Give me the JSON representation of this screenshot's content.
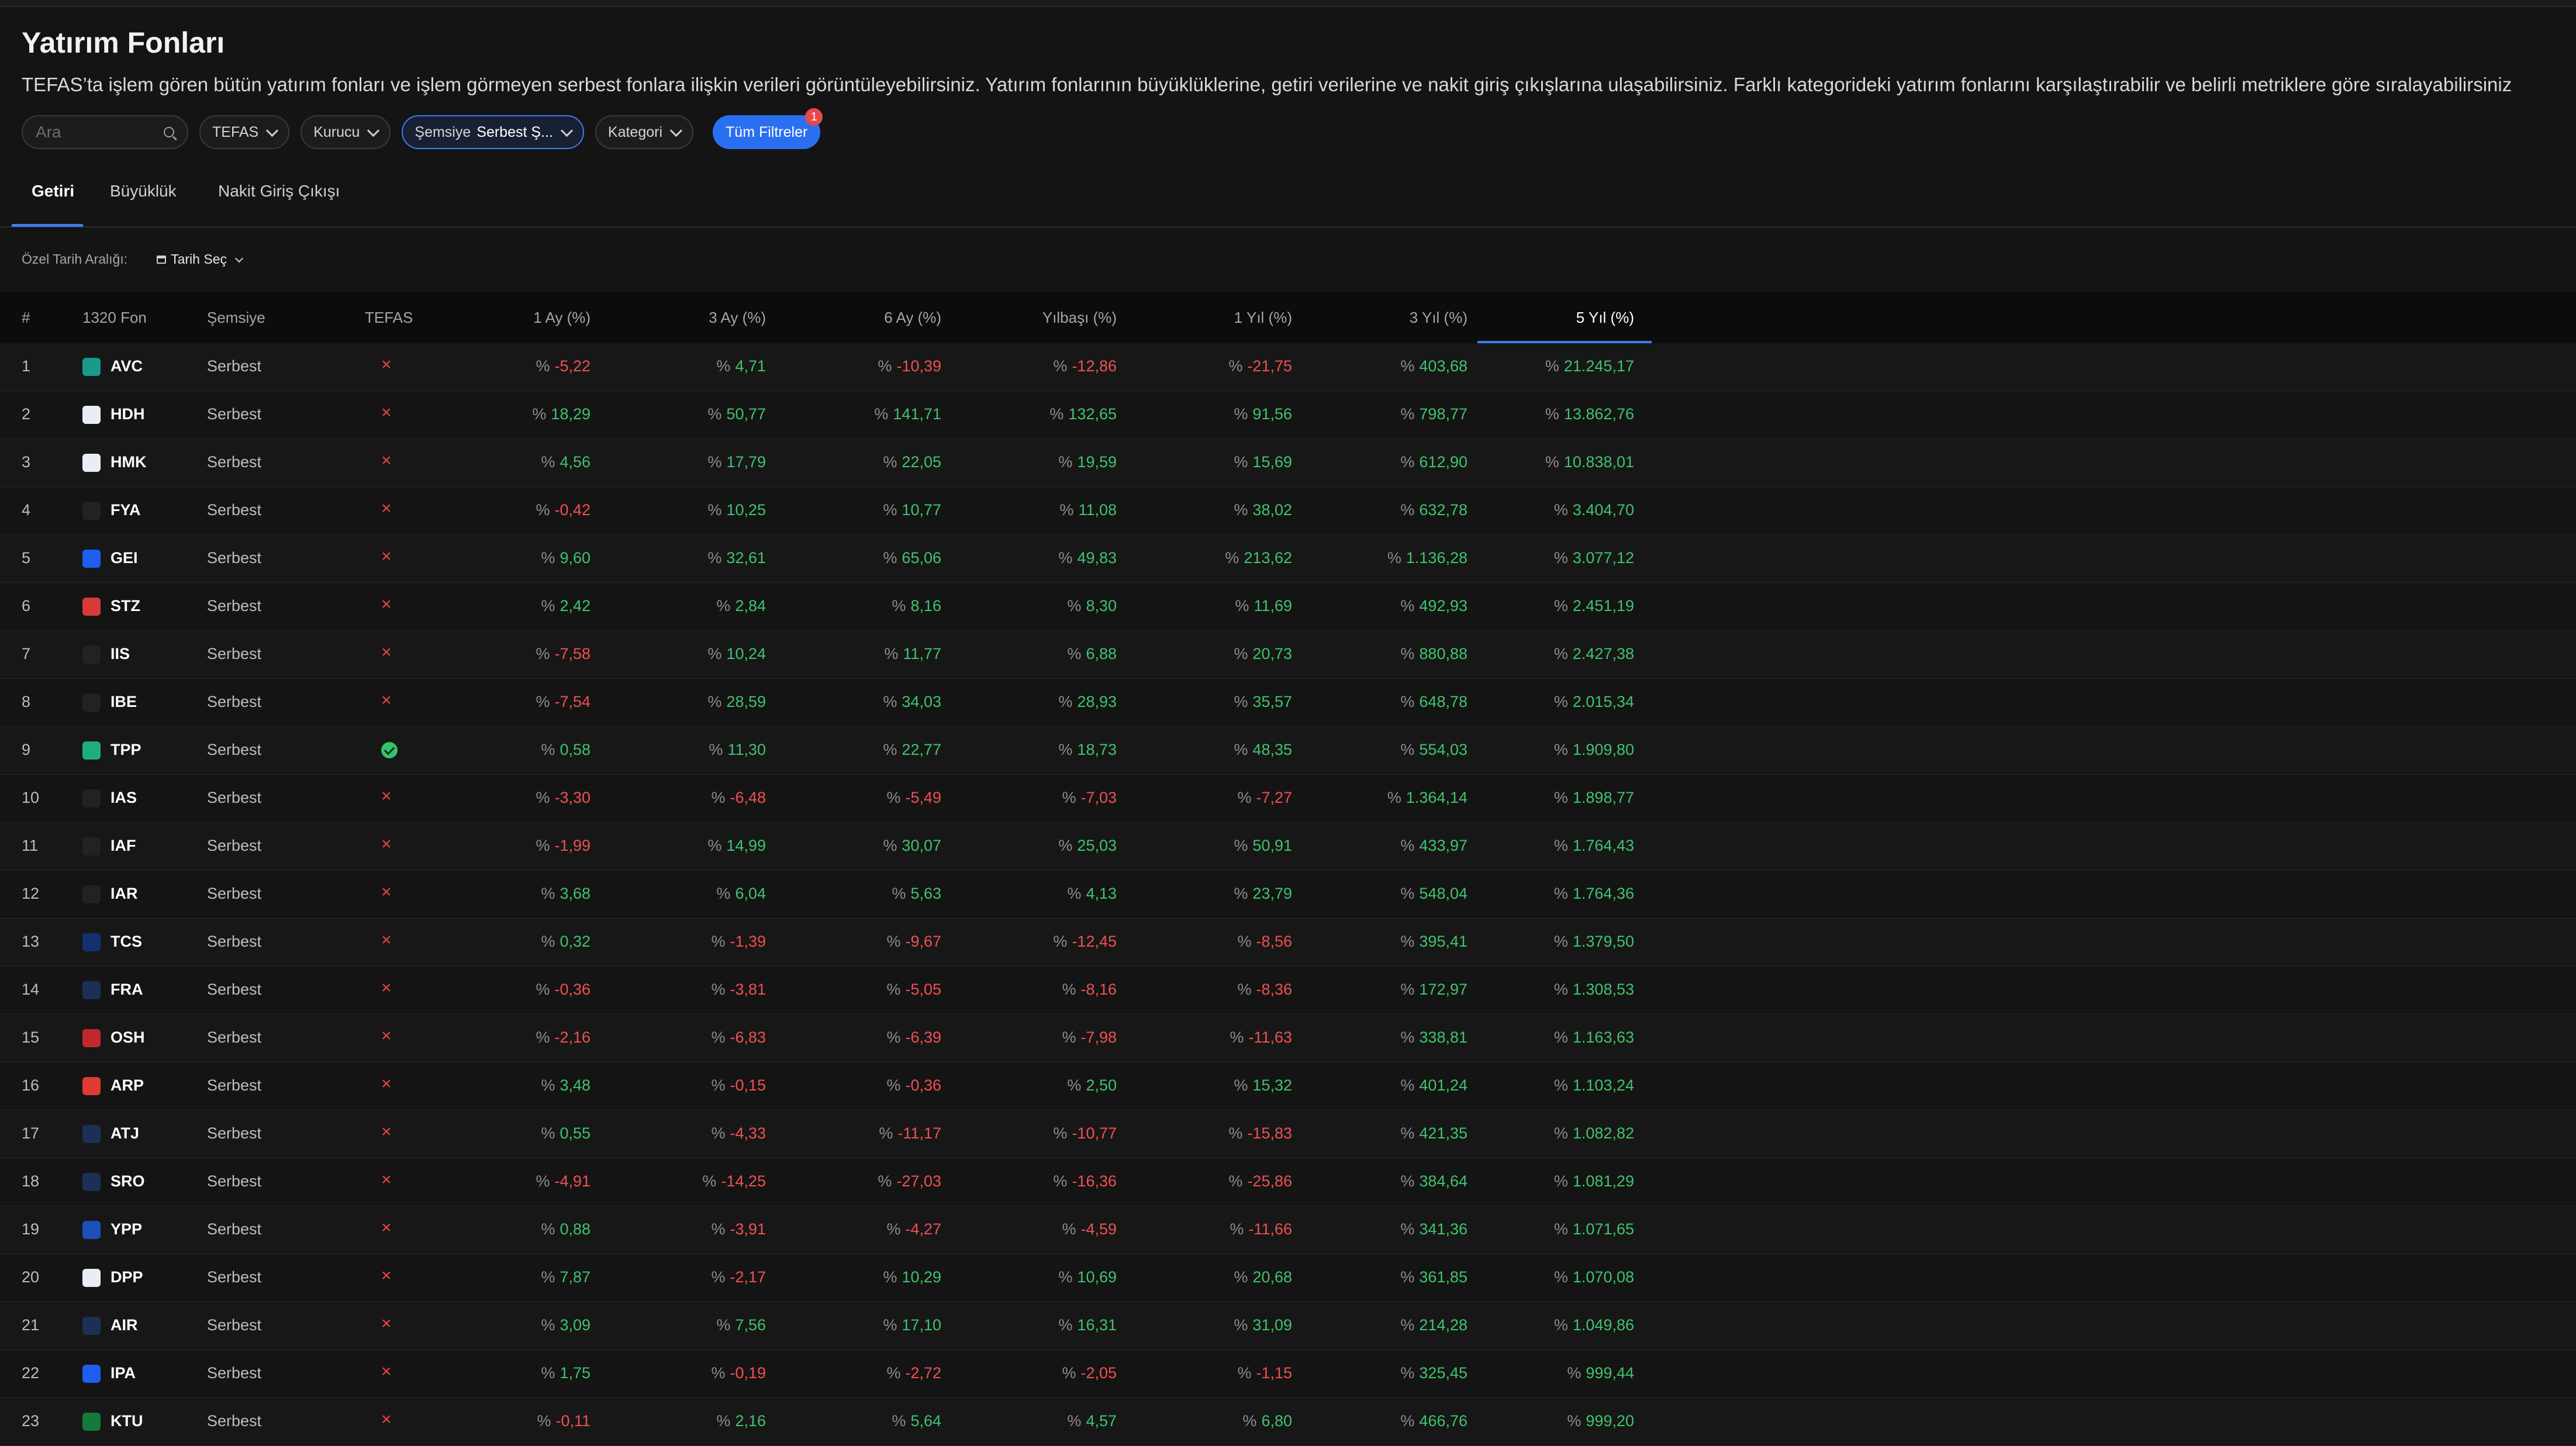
{
  "page": {
    "title": "Yatırım Fonları",
    "description": "TEFAS’ta işlem gören bütün yatırım fonları ve işlem görmeyen serbest fonlara ilişkin verileri görüntüleyebilirsiniz. Yatırım fonlarının büyüklüklerine, getiri verilerine ve nakit giriş çıkışlarına ulaşabilirsiniz. Farklı kategorideki yatırım fonlarını karşılaştırabilir ve belirli metriklere göre sıralayabilirsiniz"
  },
  "filters": {
    "search_placeholder": "Ara",
    "tefas": "TEFAS",
    "kurucu": "Kurucu",
    "semsiye_label": "Şemsiye",
    "semsiye_value": "Serbest Ş...",
    "kategori": "Kategori",
    "all_filters": "Tüm Filtreler",
    "all_filters_badge": "1"
  },
  "tabs": [
    "Getiri",
    "Büyüklük",
    "Nakit Giriş Çıkışı"
  ],
  "date_range": {
    "label": "Özel Tarih Aralığı:",
    "button": "Tarih Seç"
  },
  "table": {
    "headers": {
      "num": "#",
      "fund": "1320 Fon",
      "umbrella": "Şemsiye",
      "tefas": "TEFAS",
      "m1": "1 Ay (%)",
      "m3": "3 Ay (%)",
      "m6": "6 Ay (%)",
      "ytd": "Yılbaşı (%)",
      "y1": "1 Yıl (%)",
      "y3": "3 Yıl (%)",
      "y5": "5 Yıl (%)"
    },
    "percent_sign": "%",
    "rows": [
      {
        "num": "1",
        "code": "AVC",
        "umbrella": "Serbest",
        "tefas": false,
        "logo_color": "#1a9a8a",
        "m1": "-5,22",
        "m3": "4,71",
        "m6": "-10,39",
        "ytd": "-12,86",
        "y1": "-21,75",
        "y3": "403,68",
        "y5": "21.245,17"
      },
      {
        "num": "2",
        "code": "HDH",
        "umbrella": "Serbest",
        "tefas": false,
        "logo_color": "#e9eef5",
        "m1": "18,29",
        "m3": "50,77",
        "m6": "141,71",
        "ytd": "132,65",
        "y1": "91,56",
        "y3": "798,77",
        "y5": "13.862,76"
      },
      {
        "num": "3",
        "code": "HMK",
        "umbrella": "Serbest",
        "tefas": false,
        "logo_color": "#e9eef5",
        "m1": "4,56",
        "m3": "17,79",
        "m6": "22,05",
        "ytd": "19,59",
        "y1": "15,69",
        "y3": "612,90",
        "y5": "10.838,01"
      },
      {
        "num": "4",
        "code": "FYA",
        "umbrella": "Serbest",
        "tefas": false,
        "logo_color": "#222222",
        "m1": "-0,42",
        "m3": "10,25",
        "m6": "10,77",
        "ytd": "11,08",
        "y1": "38,02",
        "y3": "632,78",
        "y5": "3.404,70"
      },
      {
        "num": "5",
        "code": "GEI",
        "umbrella": "Serbest",
        "tefas": false,
        "logo_color": "#1d5df0",
        "m1": "9,60",
        "m3": "32,61",
        "m6": "65,06",
        "ytd": "49,83",
        "y1": "213,62",
        "y3": "1.136,28",
        "y5": "3.077,12"
      },
      {
        "num": "6",
        "code": "STZ",
        "umbrella": "Serbest",
        "tefas": false,
        "logo_color": "#d83a3a",
        "m1": "2,42",
        "m3": "2,84",
        "m6": "8,16",
        "ytd": "8,30",
        "y1": "11,69",
        "y3": "492,93",
        "y5": "2.451,19"
      },
      {
        "num": "7",
        "code": "IIS",
        "umbrella": "Serbest",
        "tefas": false,
        "logo_color": "#222222",
        "m1": "-7,58",
        "m3": "10,24",
        "m6": "11,77",
        "ytd": "6,88",
        "y1": "20,73",
        "y3": "880,88",
        "y5": "2.427,38"
      },
      {
        "num": "8",
        "code": "IBE",
        "umbrella": "Serbest",
        "tefas": false,
        "logo_color": "#222222",
        "m1": "-7,54",
        "m3": "28,59",
        "m6": "34,03",
        "ytd": "28,93",
        "y1": "35,57",
        "y3": "648,78",
        "y5": "2.015,34"
      },
      {
        "num": "9",
        "code": "TPP",
        "umbrella": "Serbest",
        "tefas": true,
        "logo_color": "#1fae7a",
        "m1": "0,58",
        "m3": "11,30",
        "m6": "22,77",
        "ytd": "18,73",
        "y1": "48,35",
        "y3": "554,03",
        "y5": "1.909,80"
      },
      {
        "num": "10",
        "code": "IAS",
        "umbrella": "Serbest",
        "tefas": false,
        "logo_color": "#222222",
        "m1": "-3,30",
        "m3": "-6,48",
        "m6": "-5,49",
        "ytd": "-7,03",
        "y1": "-7,27",
        "y3": "1.364,14",
        "y5": "1.898,77"
      },
      {
        "num": "11",
        "code": "IAF",
        "umbrella": "Serbest",
        "tefas": false,
        "logo_color": "#222222",
        "m1": "-1,99",
        "m3": "14,99",
        "m6": "30,07",
        "ytd": "25,03",
        "y1": "50,91",
        "y3": "433,97",
        "y5": "1.764,43"
      },
      {
        "num": "12",
        "code": "IAR",
        "umbrella": "Serbest",
        "tefas": false,
        "logo_color": "#222222",
        "m1": "3,68",
        "m3": "6,04",
        "m6": "5,63",
        "ytd": "4,13",
        "y1": "23,79",
        "y3": "548,04",
        "y5": "1.764,36"
      },
      {
        "num": "13",
        "code": "TCS",
        "umbrella": "Serbest",
        "tefas": false,
        "logo_color": "#14306e",
        "m1": "0,32",
        "m3": "-1,39",
        "m6": "-9,67",
        "ytd": "-12,45",
        "y1": "-8,56",
        "y3": "395,41",
        "y5": "1.379,50"
      },
      {
        "num": "14",
        "code": "FRA",
        "umbrella": "Serbest",
        "tefas": false,
        "logo_color": "#1c2f55",
        "m1": "-0,36",
        "m3": "-3,81",
        "m6": "-5,05",
        "ytd": "-8,16",
        "y1": "-8,36",
        "y3": "172,97",
        "y5": "1.308,53"
      },
      {
        "num": "15",
        "code": "OSH",
        "umbrella": "Serbest",
        "tefas": false,
        "logo_color": "#c0282d",
        "m1": "-2,16",
        "m3": "-6,83",
        "m6": "-6,39",
        "ytd": "-7,98",
        "y1": "-11,63",
        "y3": "338,81",
        "y5": "1.163,63"
      },
      {
        "num": "16",
        "code": "ARP",
        "umbrella": "Serbest",
        "tefas": false,
        "logo_color": "#e03a32",
        "m1": "3,48",
        "m3": "-0,15",
        "m6": "-0,36",
        "ytd": "2,50",
        "y1": "15,32",
        "y3": "401,24",
        "y5": "1.103,24"
      },
      {
        "num": "17",
        "code": "ATJ",
        "umbrella": "Serbest",
        "tefas": false,
        "logo_color": "#1c2f55",
        "m1": "0,55",
        "m3": "-4,33",
        "m6": "-11,17",
        "ytd": "-10,77",
        "y1": "-15,83",
        "y3": "421,35",
        "y5": "1.082,82"
      },
      {
        "num": "18",
        "code": "SRO",
        "umbrella": "Serbest",
        "tefas": false,
        "logo_color": "#1c2f55",
        "m1": "-4,91",
        "m3": "-14,25",
        "m6": "-27,03",
        "ytd": "-16,36",
        "y1": "-25,86",
        "y3": "384,64",
        "y5": "1.081,29"
      },
      {
        "num": "19",
        "code": "YPP",
        "umbrella": "Serbest",
        "tefas": false,
        "logo_color": "#1d4fb8",
        "m1": "0,88",
        "m3": "-3,91",
        "m6": "-4,27",
        "ytd": "-4,59",
        "y1": "-11,66",
        "y3": "341,36",
        "y5": "1.071,65"
      },
      {
        "num": "20",
        "code": "DPP",
        "umbrella": "Serbest",
        "tefas": false,
        "logo_color": "#e9eef5",
        "m1": "7,87",
        "m3": "-2,17",
        "m6": "10,29",
        "ytd": "10,69",
        "y1": "20,68",
        "y3": "361,85",
        "y5": "1.070,08"
      },
      {
        "num": "21",
        "code": "AIR",
        "umbrella": "Serbest",
        "tefas": false,
        "logo_color": "#1c2f55",
        "m1": "3,09",
        "m3": "7,56",
        "m6": "17,10",
        "ytd": "16,31",
        "y1": "31,09",
        "y3": "214,28",
        "y5": "1.049,86"
      },
      {
        "num": "22",
        "code": "IPA",
        "umbrella": "Serbest",
        "tefas": false,
        "logo_color": "#1d5df0",
        "m1": "1,75",
        "m3": "-0,19",
        "m6": "-2,72",
        "ytd": "-2,05",
        "y1": "-1,15",
        "y3": "325,45",
        "y5": "999,44"
      },
      {
        "num": "23",
        "code": "KTU",
        "umbrella": "Serbest",
        "tefas": false,
        "logo_color": "#137a3c",
        "m1": "-0,11",
        "m3": "2,16",
        "m6": "5,64",
        "ytd": "4,57",
        "y1": "6,80",
        "y3": "466,76",
        "y5": "999,20"
      }
    ]
  },
  "colors": {
    "accent": "#2a6ff0",
    "positive": "#3ec46d",
    "negative": "#ef5053"
  }
}
